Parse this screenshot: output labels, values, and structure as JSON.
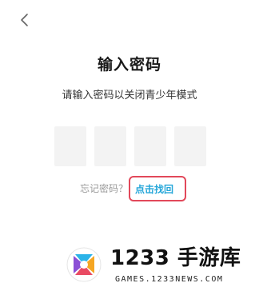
{
  "header": {
    "back_icon": "chevron-left-icon"
  },
  "main": {
    "title": "输入密码",
    "subtitle": "请输入密码以关闭青少年模式",
    "code_box_count": 4,
    "forgot_text": "忘记密码？",
    "find_back_link": "点击找回",
    "colors": {
      "link": "#23a6d9",
      "highlight_frame": "#e2485a",
      "box_bg": "#f3f3f3"
    }
  },
  "watermark": {
    "brand": "1233 手游库",
    "url": "GAMES.1233NEWS.COM"
  }
}
